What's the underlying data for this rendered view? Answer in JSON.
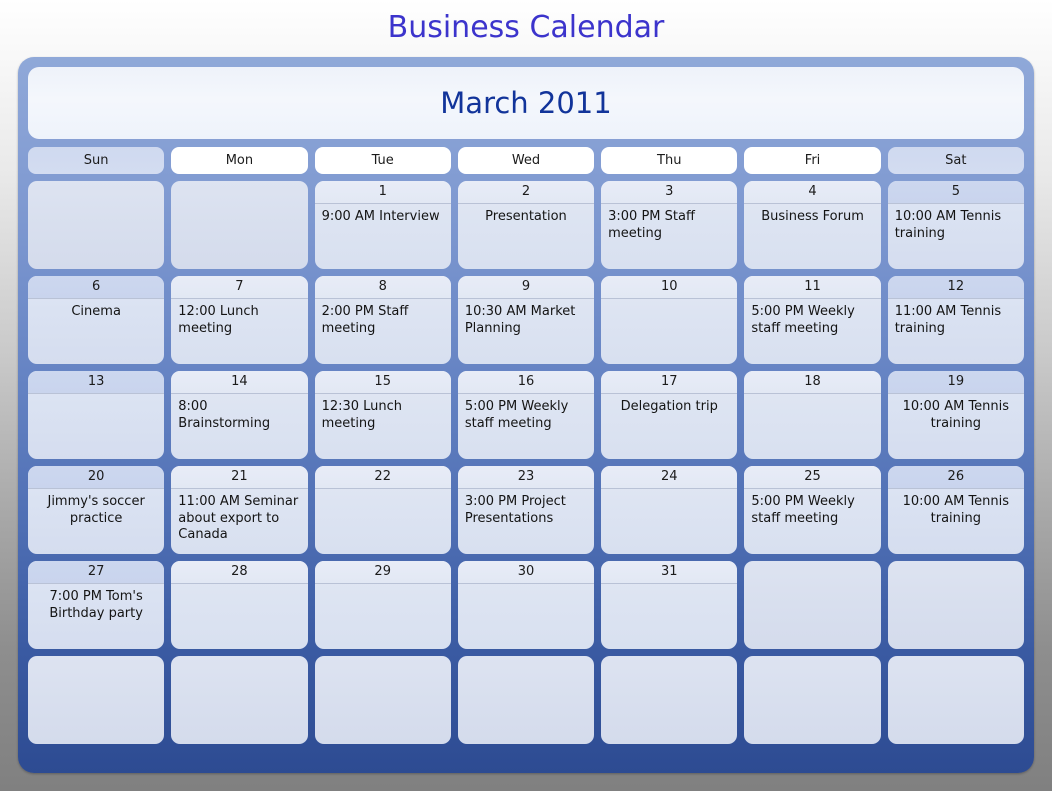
{
  "page": {
    "title": "Business Calendar",
    "title_color": "#3c34cc"
  },
  "calendar": {
    "month_label": "March 2011",
    "month_label_color": "#12349a",
    "frame_color_top": "#8fa8d8",
    "frame_color_bottom": "#2d4b92",
    "weekday_headers": [
      {
        "label": "Sun",
        "weekend": true
      },
      {
        "label": "Mon",
        "weekend": false
      },
      {
        "label": "Tue",
        "weekend": false
      },
      {
        "label": "Wed",
        "weekend": false
      },
      {
        "label": "Thu",
        "weekend": false
      },
      {
        "label": "Fri",
        "weekend": false
      },
      {
        "label": "Sat",
        "weekend": true
      }
    ],
    "weeks": [
      [
        {
          "day": "",
          "event": "",
          "align": "center",
          "weekend": true,
          "blank": true
        },
        {
          "day": "",
          "event": "",
          "align": "center",
          "weekend": false,
          "blank": true
        },
        {
          "day": "1",
          "event": "9:00 AM Interview",
          "align": "left",
          "weekend": false,
          "blank": false
        },
        {
          "day": "2",
          "event": "Presentation",
          "align": "center",
          "weekend": false,
          "blank": false
        },
        {
          "day": "3",
          "event": "3:00 PM Staff meeting",
          "align": "left",
          "weekend": false,
          "blank": false
        },
        {
          "day": "4",
          "event": "Business Forum",
          "align": "center",
          "weekend": false,
          "blank": false
        },
        {
          "day": "5",
          "event": "10:00 AM Tennis training",
          "align": "left",
          "weekend": true,
          "blank": false
        }
      ],
      [
        {
          "day": "6",
          "event": "Cinema",
          "align": "center",
          "weekend": true,
          "blank": false
        },
        {
          "day": "7",
          "event": "12:00 Lunch meeting",
          "align": "left",
          "weekend": false,
          "blank": false
        },
        {
          "day": "8",
          "event": "2:00 PM Staff meeting",
          "align": "left",
          "weekend": false,
          "blank": false
        },
        {
          "day": "9",
          "event": "10:30 AM Market Planning",
          "align": "left",
          "weekend": false,
          "blank": false
        },
        {
          "day": "10",
          "event": "",
          "align": "center",
          "weekend": false,
          "blank": false
        },
        {
          "day": "11",
          "event": "5:00 PM Weekly staff meeting",
          "align": "left",
          "weekend": false,
          "blank": false
        },
        {
          "day": "12",
          "event": "11:00 AM Tennis training",
          "align": "left",
          "weekend": true,
          "blank": false
        }
      ],
      [
        {
          "day": "13",
          "event": "",
          "align": "center",
          "weekend": true,
          "blank": false
        },
        {
          "day": "14",
          "event": "8:00 Brainstorming",
          "align": "left",
          "weekend": false,
          "blank": false
        },
        {
          "day": "15",
          "event": "12:30 Lunch meeting",
          "align": "left",
          "weekend": false,
          "blank": false
        },
        {
          "day": "16",
          "event": "5:00 PM Weekly staff meeting",
          "align": "left",
          "weekend": false,
          "blank": false
        },
        {
          "day": "17",
          "event": "Delegation trip",
          "align": "center",
          "weekend": false,
          "blank": false
        },
        {
          "day": "18",
          "event": "",
          "align": "center",
          "weekend": false,
          "blank": false
        },
        {
          "day": "19",
          "event": "10:00 AM Tennis training",
          "align": "center",
          "weekend": true,
          "blank": false
        }
      ],
      [
        {
          "day": "20",
          "event": "Jimmy's soccer practice",
          "align": "center",
          "weekend": true,
          "blank": false
        },
        {
          "day": "21",
          "event": "11:00 AM Seminar about export to Canada",
          "align": "left",
          "weekend": false,
          "blank": false
        },
        {
          "day": "22",
          "event": "",
          "align": "center",
          "weekend": false,
          "blank": false
        },
        {
          "day": "23",
          "event": "3:00 PM Project Presentations",
          "align": "left",
          "weekend": false,
          "blank": false
        },
        {
          "day": "24",
          "event": "",
          "align": "center",
          "weekend": false,
          "blank": false
        },
        {
          "day": "25",
          "event": "5:00 PM Weekly staff meeting",
          "align": "left",
          "weekend": false,
          "blank": false
        },
        {
          "day": "26",
          "event": "10:00 AM Tennis training",
          "align": "center",
          "weekend": true,
          "blank": false
        }
      ],
      [
        {
          "day": "27",
          "event": "7:00 PM Tom's Birthday party",
          "align": "center",
          "weekend": true,
          "blank": false
        },
        {
          "day": "28",
          "event": "",
          "align": "center",
          "weekend": false,
          "blank": false
        },
        {
          "day": "29",
          "event": "",
          "align": "center",
          "weekend": false,
          "blank": false
        },
        {
          "day": "30",
          "event": "",
          "align": "center",
          "weekend": false,
          "blank": false
        },
        {
          "day": "31",
          "event": "",
          "align": "center",
          "weekend": false,
          "blank": false
        },
        {
          "day": "",
          "event": "",
          "align": "center",
          "weekend": false,
          "blank": true
        },
        {
          "day": "",
          "event": "",
          "align": "center",
          "weekend": true,
          "blank": true
        }
      ],
      [
        {
          "day": "",
          "event": "",
          "align": "center",
          "weekend": true,
          "blank": true
        },
        {
          "day": "",
          "event": "",
          "align": "center",
          "weekend": false,
          "blank": true
        },
        {
          "day": "",
          "event": "",
          "align": "center",
          "weekend": false,
          "blank": true
        },
        {
          "day": "",
          "event": "",
          "align": "center",
          "weekend": false,
          "blank": true
        },
        {
          "day": "",
          "event": "",
          "align": "center",
          "weekend": false,
          "blank": true
        },
        {
          "day": "",
          "event": "",
          "align": "center",
          "weekend": false,
          "blank": true
        },
        {
          "day": "",
          "event": "",
          "align": "center",
          "weekend": true,
          "blank": true
        }
      ]
    ]
  }
}
